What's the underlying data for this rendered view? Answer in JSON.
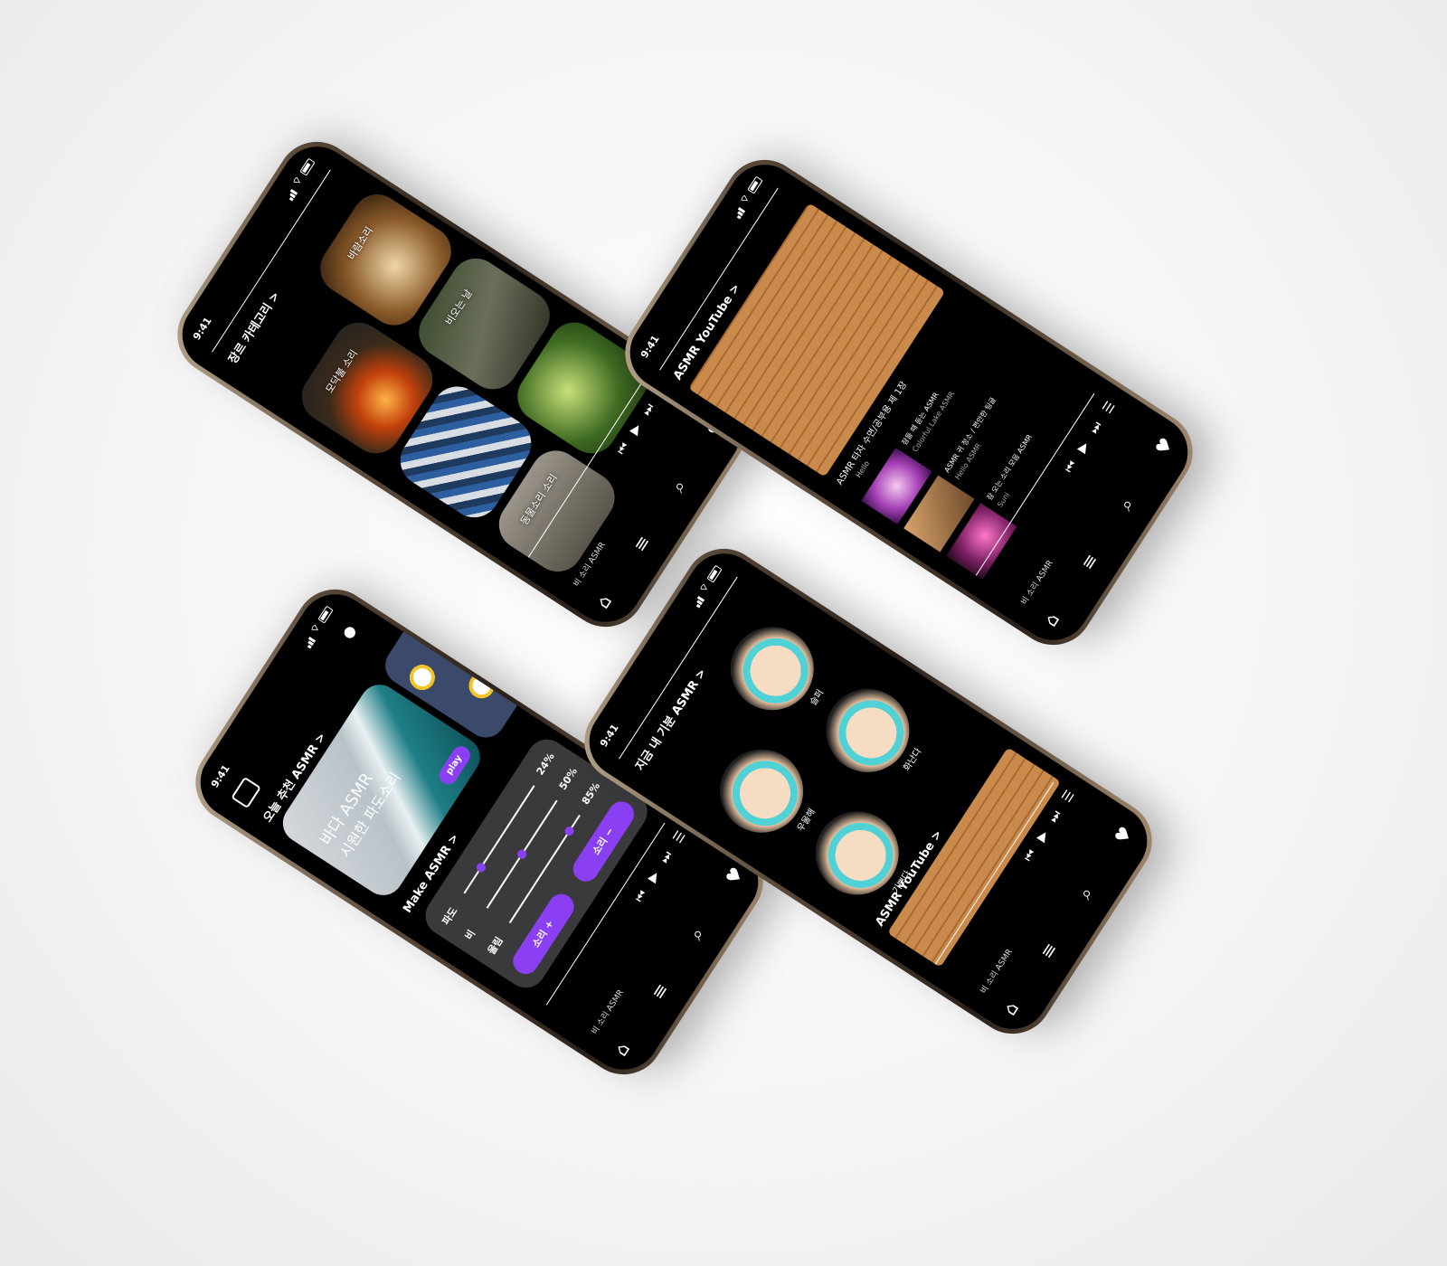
{
  "status": {
    "time": "9:41"
  },
  "now_playing": "비 소리 ASMR",
  "nav": {
    "home": "⌂",
    "library": "≡",
    "search": "⌕",
    "like": "♥",
    "queue": "☰",
    "prev": "⏮",
    "play": "▶",
    "next": "⏭"
  },
  "phone1": {
    "title": "장르 카테고리 >",
    "tiles": [
      {
        "label": "바람소리"
      },
      {
        "label": "모닥불 소리"
      },
      {
        "label": "비오는 날"
      },
      {
        "label": ""
      },
      {
        "label": ""
      },
      {
        "label": "동물소리 소리"
      }
    ]
  },
  "phone2": {
    "title": "ASMR YouTube >",
    "hero_caption": "ASMR 타자 수면/공부용 제 1장",
    "channel": "Hello",
    "items": [
      {
        "title": "잠들 때 듣는 ASMR",
        "channel": "Colorful Lake ASMR"
      },
      {
        "title": "ASMR 귀 청소 / 편안한 팅글",
        "channel": "Hello ASMR"
      },
      {
        "title": "잠 오는 소리 모음 ASMR",
        "channel": "Suni"
      }
    ]
  },
  "phone3": {
    "title": "오늘 추천 ASMR >",
    "card_title": "바다 ASMR",
    "card_sub": "시원한 파도소리",
    "play": "play",
    "make_title": "Make ASMR >",
    "sliders": [
      {
        "label": "파도",
        "value": "24%",
        "level": 0.24
      },
      {
        "label": "비",
        "value": "50%",
        "level": 0.5
      },
      {
        "label": "울림",
        "value": "85%",
        "level": 0.85
      }
    ],
    "btn_plus": "소리 +",
    "btn_minus": "소리 −"
  },
  "phone4": {
    "title": "지금 내 기분 ASMR >",
    "moods": [
      {
        "label": "슬퍼"
      },
      {
        "label": "우울해"
      },
      {
        "label": "화난다"
      },
      {
        "label": "기쁘다"
      }
    ],
    "youtube_title": "ASMR YouTube >"
  },
  "colors": {
    "accent": "#8a3ff2",
    "bg": "#000000",
    "teal": "#4fd1d6",
    "skin": "#f0cba7"
  }
}
